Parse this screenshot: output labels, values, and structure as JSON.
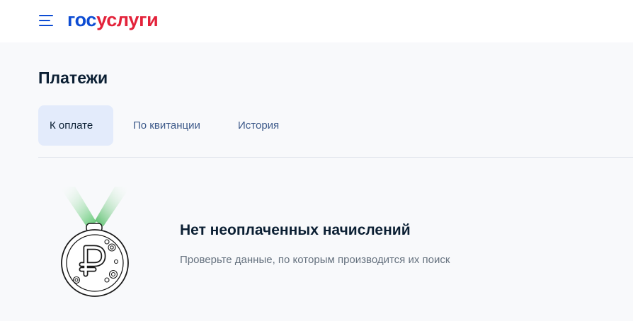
{
  "header": {
    "logo_part1": "гос",
    "logo_part2": "услуги",
    "menu_icon": "hamburger-icon"
  },
  "page": {
    "title": "Платежи"
  },
  "tabs": [
    {
      "label": "К оплате",
      "active": true
    },
    {
      "label": "По квитанции",
      "active": false
    },
    {
      "label": "История",
      "active": false
    }
  ],
  "empty_state": {
    "icon": "ruble-medal-icon",
    "title": "Нет неоплаченных начислений",
    "description": "Проверьте данные, по которым производится их поиск"
  },
  "colors": {
    "brand_blue": "#0d4cd3",
    "brand_red": "#e3223a",
    "active_tab_bg": "#e3ebfb",
    "page_bg": "#f8f9fb",
    "text_dark": "#0b1f33",
    "text_muted": "#66727f",
    "medal_ribbon": "#56c46a"
  }
}
